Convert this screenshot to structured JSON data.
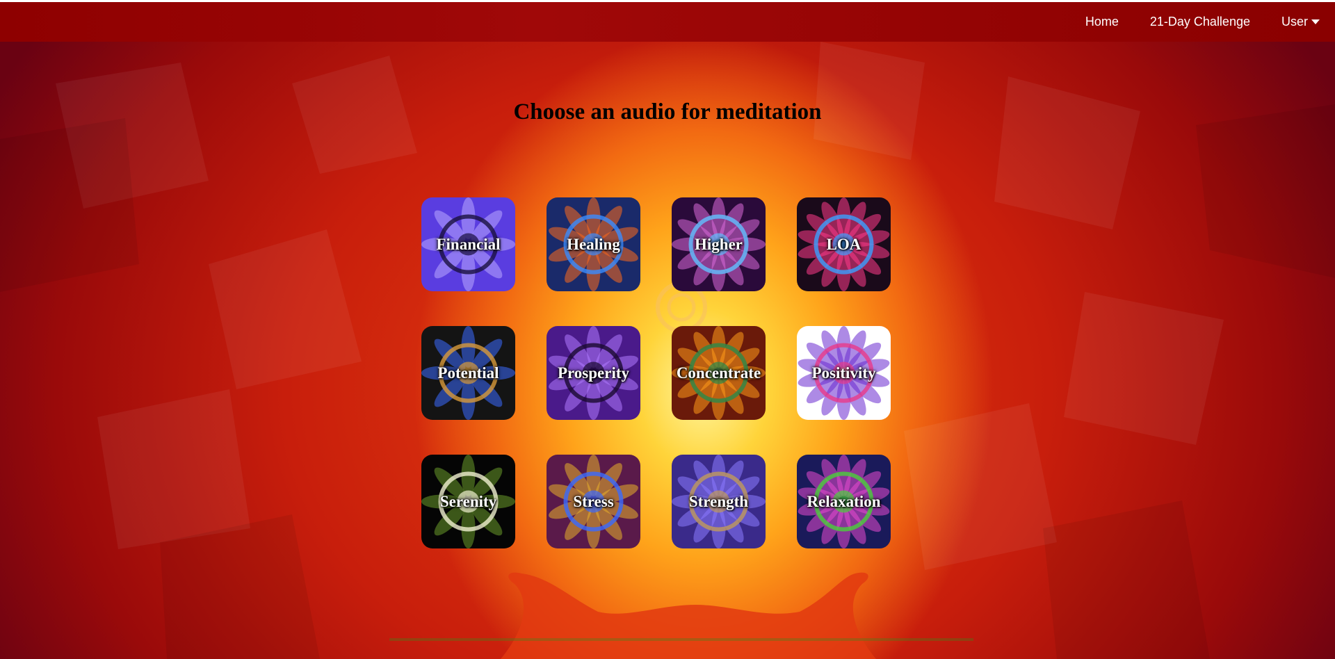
{
  "nav": {
    "home_label": "Home",
    "challenge_label": "21-Day Challenge",
    "user_label": "User"
  },
  "page": {
    "title": "Choose an audio for meditation"
  },
  "tiles": [
    {
      "label": "Financial",
      "bg": "#5a3de0",
      "accent": "#b9a8ff",
      "ring": "#1a1040"
    },
    {
      "label": "Healing",
      "bg": "#1a2a6a",
      "accent": "#ff6a1a",
      "ring": "#3a8cff"
    },
    {
      "label": "Higher",
      "bg": "#2a0a3a",
      "accent": "#d86ad8",
      "ring": "#60c0ff"
    },
    {
      "label": "LOA",
      "bg": "#1a0a1a",
      "accent": "#ff3a8a",
      "ring": "#3aa0ff"
    },
    {
      "label": "Potential",
      "bg": "#141414",
      "accent": "#3a6aff",
      "ring": "#d89a3a"
    },
    {
      "label": "Prosperity",
      "bg": "#4a1a8a",
      "accent": "#b07aff",
      "ring": "#1a0a30"
    },
    {
      "label": "Concentrate",
      "bg": "#6a1a0a",
      "accent": "#ff9a1a",
      "ring": "#2a8a4a"
    },
    {
      "label": "Positivity",
      "bg": "#ffffff",
      "accent": "#6a2ad0",
      "ring": "#e83a8a"
    },
    {
      "label": "Serenity",
      "bg": "#050505",
      "accent": "#6a9a2a",
      "ring": "#f0f0d0"
    },
    {
      "label": "Stress",
      "bg": "#5a1a4a",
      "accent": "#e8b02a",
      "ring": "#3a6aff"
    },
    {
      "label": "Strength",
      "bg": "#3a2a8a",
      "accent": "#8a7aff",
      "ring": "#c09a5a"
    },
    {
      "label": "Relaxation",
      "bg": "#1a1a5a",
      "accent": "#e84ad0",
      "ring": "#4ad03a"
    }
  ]
}
